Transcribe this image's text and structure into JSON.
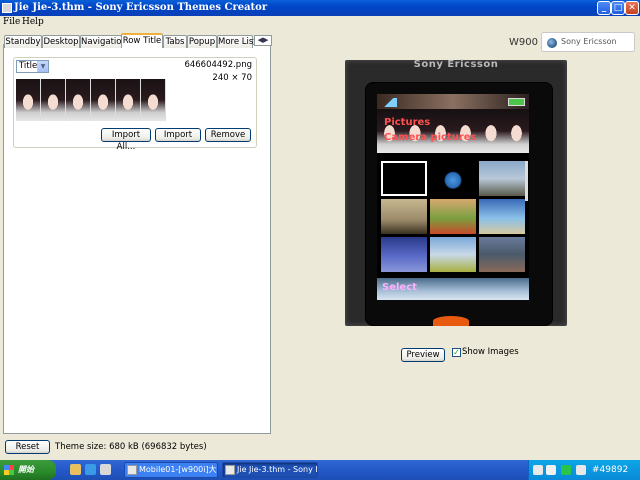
{
  "window": {
    "title": "Jie Jie-3.thm - Sony Ericsson Themes Creator",
    "minimize_symbol": "_",
    "maximize_symbol": "□",
    "close_symbol": "✕"
  },
  "menu": {
    "file": "File",
    "help": "Help"
  },
  "tabs": {
    "items": [
      "Standby",
      "Desktop",
      "Navigation",
      "Row Title",
      "Tabs",
      "Popup",
      "More List"
    ],
    "active": "Row Title",
    "scroll_left": "◀",
    "scroll_right": "▶"
  },
  "row_title_panel": {
    "selected_option": "Title",
    "file_name": "646604492.png",
    "dimensions": "240 × 70",
    "buttons": {
      "import_all": "Import All...",
      "import": "Import",
      "remove": "Remove"
    }
  },
  "bottom": {
    "reset_label": "Reset",
    "theme_size": "Theme size: 680 kB (696832 bytes)"
  },
  "phone": {
    "model": "W900",
    "brand": "Sony Ericsson",
    "header_brand": "Sony Ericsson",
    "screen_title_1": "Pictures",
    "screen_title_2": "Camera pictures",
    "softkey_label": "Select"
  },
  "preview": {
    "preview_label": "Preview",
    "show_images_label": "Show Images",
    "show_images_checked": true,
    "check_mark": "✓"
  },
  "taskbar": {
    "start_label": "開始",
    "tasks": [
      {
        "label": "Mobile01-[w900i]大...",
        "active": false
      },
      {
        "label": "Jie Jie-3.thm - Sony Er...",
        "active": true
      }
    ],
    "tray_text": "#49892"
  },
  "colors": {
    "titlebar": "#0046c8",
    "taskbar": "#245ac8",
    "start": "#2a8a2a",
    "active_tab_accent": "#f0b040",
    "screen_title": "#ff5050"
  }
}
